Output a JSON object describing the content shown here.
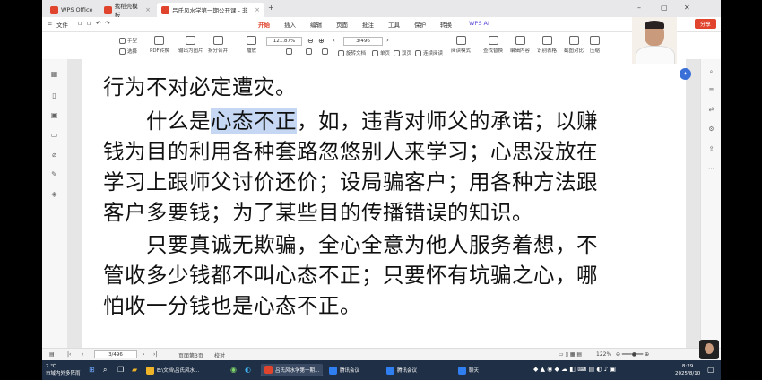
{
  "tabs": [
    {
      "label": "WPS Office",
      "color": "#e0442c"
    },
    {
      "label": "找稻壳模板",
      "color": "#e0442c"
    },
    {
      "label": "吕氏风水学第一期公开课 - 非",
      "color": "#e0442c"
    }
  ],
  "menu": {
    "file": "文件",
    "items": [
      "开始",
      "插入",
      "编辑",
      "页面",
      "批注",
      "工具",
      "保护",
      "转换"
    ],
    "active_index": 0,
    "ai": "WPS AI",
    "share": "分享"
  },
  "toolbar": {
    "hand": "手型",
    "select": "选择",
    "items": [
      "PDF转换",
      "输出为图片",
      "拆分合并",
      "播放"
    ],
    "zoom": "121.87%",
    "page": "3/496",
    "rotate": "旋转文档",
    "single": "单页",
    "double": "双页",
    "continuous": "连续阅读",
    "read_mode": "阅读模式",
    "right_items": [
      "查找替换",
      "编辑内容",
      "识别表格",
      "截图对比",
      "压缩"
    ]
  },
  "document": {
    "lines": [
      {
        "pre": "行为不对必定遭灾。",
        "hl": "",
        "post": ""
      },
      {
        "pre": "　　什么是",
        "hl": "心态不正",
        "post": "，如，违背对师父的承诺；以赚"
      },
      {
        "pre": "钱为目的利用各种套路忽悠别人来学习；心思没放在",
        "hl": "",
        "post": ""
      },
      {
        "pre": "学习上跟师父讨价还价；设局骗客户；用各种方法跟",
        "hl": "",
        "post": ""
      },
      {
        "pre": "客户多要钱；为了某些目的传播错误的知识。",
        "hl": "",
        "post": ""
      },
      {
        "pre": "　　只要真诚无欺骗，全心全意为他人服务着想，不",
        "hl": "",
        "post": ""
      },
      {
        "pre": "管收多少钱都不叫心态不正；只要怀有坑骗之心，哪",
        "hl": "",
        "post": ""
      },
      {
        "pre": "怕收一分钱也是心态不正。",
        "hl": "",
        "post": ""
      }
    ]
  },
  "statusbar": {
    "page": "3/496",
    "page_info": "页面第3页",
    "proofread": "校对",
    "zoom": "122%"
  },
  "taskbar": {
    "weather_top": "7 ℃",
    "weather_bottom": "市域内外多阵雨",
    "items": [
      {
        "label": "E:\\文档\\吕氏风水...",
        "color": "#f0b429"
      },
      {
        "label": "吕氏风水学第一期...",
        "color": "#e0442c"
      },
      {
        "label": "腾讯会议",
        "color": "#2f7ff0"
      },
      {
        "label": "腾讯会议",
        "color": "#2f7ff0"
      },
      {
        "label": "聊天",
        "color": "#2f7ff0"
      }
    ],
    "time": "8:29",
    "date": "2025/8/10"
  }
}
